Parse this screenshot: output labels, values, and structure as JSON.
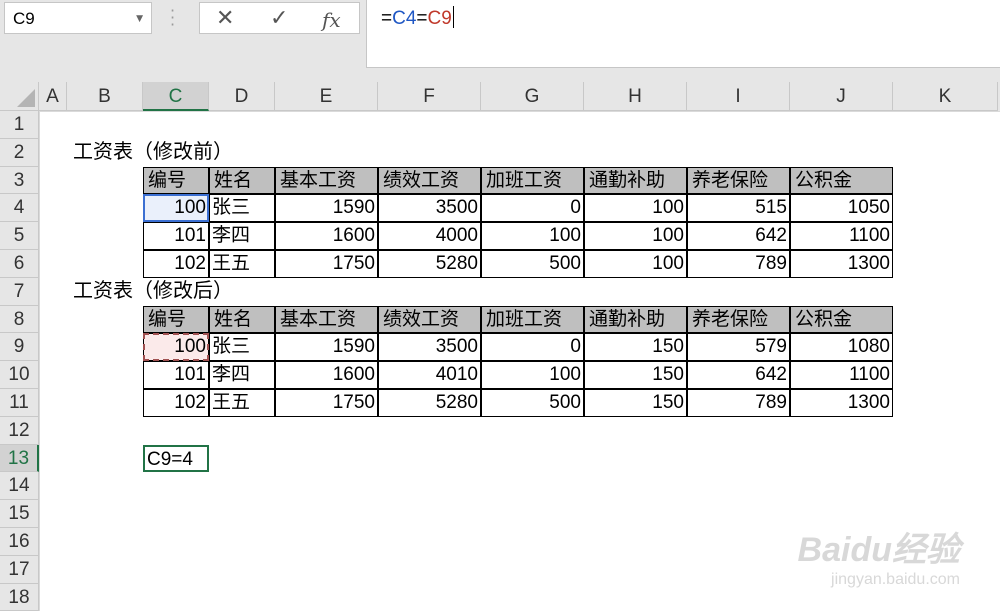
{
  "name_box": {
    "value": "C9"
  },
  "formula_bar": {
    "buttons": {
      "cancel": "✕",
      "enter": "✓",
      "fx": "fx"
    },
    "formula_parts": [
      {
        "text": "=",
        "color": "#000000"
      },
      {
        "text": "C4",
        "color": "#1f57c4"
      },
      {
        "text": "=",
        "color": "#000000"
      },
      {
        "text": "C9",
        "color": "#c0392b"
      }
    ]
  },
  "columns": [
    "A",
    "B",
    "C",
    "D",
    "E",
    "F",
    "G",
    "H",
    "I",
    "J",
    "K"
  ],
  "selected_column": "C",
  "rows": [
    "1",
    "2",
    "3",
    "4",
    "5",
    "6",
    "7",
    "8",
    "9",
    "10",
    "11",
    "12",
    "13",
    "14",
    "15",
    "16",
    "17",
    "18"
  ],
  "selected_row": "13",
  "table1": {
    "title": "工资表（修改前）",
    "headers": [
      "编号",
      "姓名",
      "基本工资",
      "绩效工资",
      "加班工资",
      "通勤补助",
      "养老保险",
      "公积金"
    ],
    "rows": [
      [
        "100",
        "张三",
        "1590",
        "3500",
        "0",
        "100",
        "515",
        "1050"
      ],
      [
        "101",
        "李四",
        "1600",
        "4000",
        "100",
        "100",
        "642",
        "1100"
      ],
      [
        "102",
        "王五",
        "1750",
        "5280",
        "500",
        "100",
        "789",
        "1300"
      ]
    ]
  },
  "table2": {
    "title": "工资表（修改后）",
    "headers": [
      "编号",
      "姓名",
      "基本工资",
      "绩效工资",
      "加班工资",
      "通勤补助",
      "养老保险",
      "公积金"
    ],
    "rows": [
      [
        "100",
        "张三",
        "1590",
        "3500",
        "0",
        "150",
        "579",
        "1080"
      ],
      [
        "101",
        "李四",
        "1600",
        "4010",
        "100",
        "150",
        "642",
        "1100"
      ],
      [
        "102",
        "王五",
        "1750",
        "5280",
        "500",
        "150",
        "789",
        "1300"
      ]
    ]
  },
  "active_cell": {
    "address": "C13",
    "editing_text": "4=C9"
  },
  "watermark": {
    "brand": "Baidu经验",
    "url": "jingyan.baidu.com"
  }
}
